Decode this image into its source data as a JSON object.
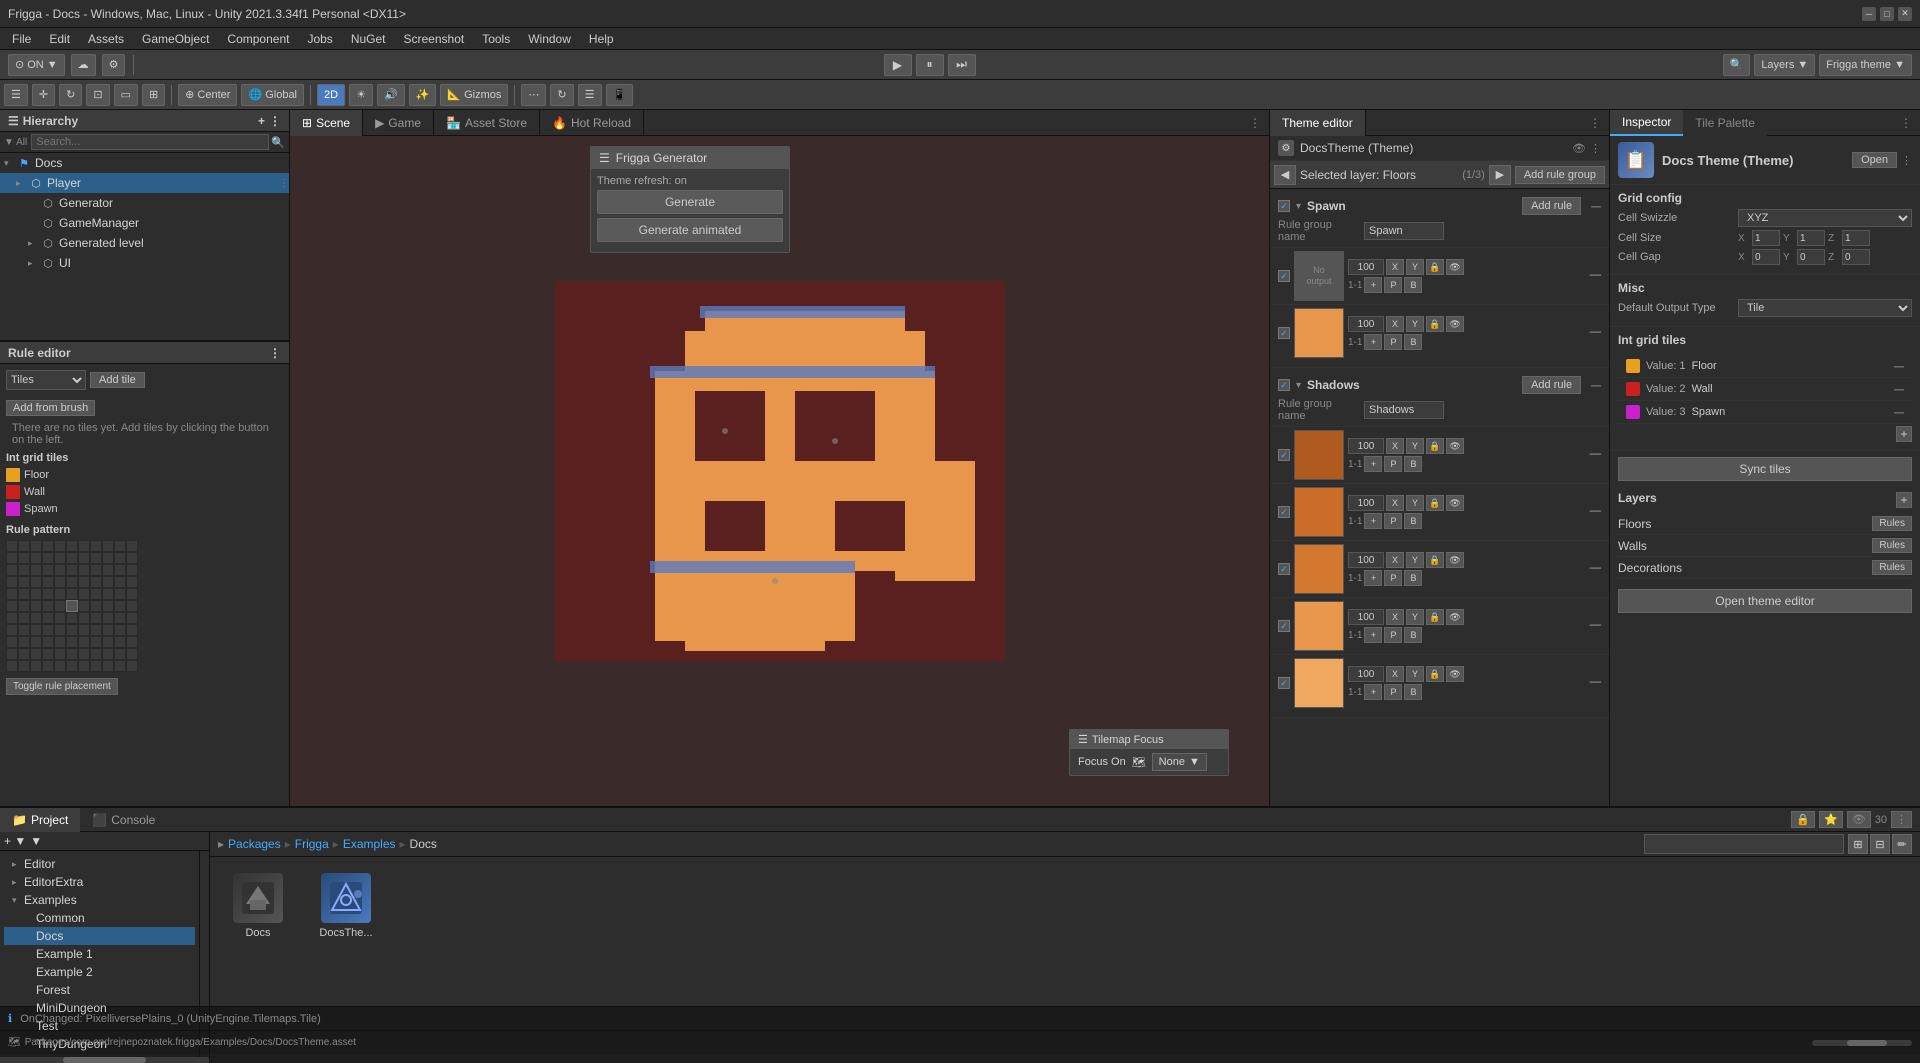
{
  "titlebar": {
    "title": "Frigga - Docs - Windows, Mac, Linux - Unity 2021.3.34f1 Personal <DX11>",
    "buttons": [
      "─",
      "□",
      "✕"
    ]
  },
  "menubar": {
    "items": [
      "File",
      "Edit",
      "Assets",
      "GameObject",
      "Component",
      "Jobs",
      "NuGet",
      "Screenshot",
      "Tools",
      "Window",
      "Help"
    ]
  },
  "toolbar": {
    "left": {
      "toggle_label": "ON",
      "cloud_label": "☁",
      "settings_label": "⚙"
    },
    "play": "▶",
    "pause": "⏸",
    "step": "⏭",
    "right": {
      "layers_label": "Layers",
      "frigga_label": "Frigga theme ▼"
    }
  },
  "scene_toolbar": {
    "buttons": [
      "☰",
      "↔",
      "↕",
      "⟲",
      "⊡",
      "2D",
      "☀",
      "⋯",
      "⟲",
      "☰",
      "📱",
      "☁",
      "📐"
    ]
  },
  "hierarchy": {
    "title": "Hierarchy",
    "search_placeholder": "Search...",
    "items": [
      {
        "label": "Docs",
        "depth": 0,
        "type": "scene",
        "expanded": true
      },
      {
        "label": "Player",
        "depth": 1,
        "type": "gameobject",
        "selected": true,
        "expanded": false
      },
      {
        "label": "Generator",
        "depth": 2,
        "type": "gameobject"
      },
      {
        "label": "GameManager",
        "depth": 2,
        "type": "gameobject"
      },
      {
        "label": "Generated level",
        "depth": 2,
        "type": "gameobject",
        "expanded": false
      },
      {
        "label": "UI",
        "depth": 2,
        "type": "gameobject",
        "expanded": false
      }
    ]
  },
  "scene_tabs": {
    "tabs": [
      "Scene",
      "Game",
      "Asset Store",
      "Hot Reload"
    ],
    "active": 0
  },
  "frigga_generator": {
    "title": "Frigga Generator",
    "theme_refresh": "Theme refresh: on",
    "generate_btn": "Generate",
    "generate_animated_btn": "Generate animated"
  },
  "tilemap_focus": {
    "title": "Tilemap Focus",
    "focus_on_label": "Focus On",
    "none_option": "None",
    "icon": "🗺"
  },
  "theme_editor": {
    "title": "Theme editor",
    "docs_theme": "DocsTheme (Theme)",
    "layer_nav": {
      "prev": "◀",
      "label": "Selected layer: Floors",
      "page": "(1/3)",
      "next": "▶"
    },
    "add_rule_group_btn": "Add rule group",
    "rule_groups": [
      {
        "name": "Spawn",
        "expanded": true,
        "add_rule": "Add rule",
        "rules": [
          {
            "type": "no_output",
            "value": 100
          },
          {
            "type": "tile",
            "value": 100,
            "color": "#e8964c"
          }
        ]
      },
      {
        "name": "Shadows",
        "expanded": true,
        "add_rule": "Add rule",
        "rules": [
          {
            "type": "tile",
            "value": 100,
            "color": "#b05a20"
          },
          {
            "type": "tile",
            "value": 100,
            "color": "#cc6e2a"
          },
          {
            "type": "tile",
            "value": 100,
            "color": "#c96a28"
          },
          {
            "type": "tile",
            "value": 100,
            "color": "#d47830"
          },
          {
            "type": "tile",
            "value": 100,
            "color": "#e8964c"
          }
        ]
      }
    ]
  },
  "inspector": {
    "title": "Inspector",
    "tile_palette": "Tile Palette",
    "docs_theme_name": "Docs Theme (Theme)",
    "open_btn": "Open",
    "grid_config": {
      "title": "Grid config",
      "cell_swizzle_label": "Cell Swizzle",
      "cell_swizzle_value": "XYZ",
      "cell_size_label": "Cell Size",
      "cell_size_x": "1",
      "cell_size_y": "1",
      "cell_size_z": "1",
      "cell_gap_label": "Cell Gap",
      "cell_gap_x": "0",
      "cell_gap_y": "0",
      "cell_gap_z": "0"
    },
    "misc": {
      "title": "Misc",
      "default_output_label": "Default Output Type",
      "default_output_value": "Tile"
    },
    "int_grid_tiles": {
      "title": "Int grid tiles",
      "tiles": [
        {
          "color": "#e8a020",
          "value": "Value: 1",
          "name": "Floor"
        },
        {
          "color": "#cc2020",
          "value": "Value: 2",
          "name": "Wall"
        },
        {
          "color": "#cc20cc",
          "value": "Value: 3",
          "name": "Spawn"
        }
      ]
    },
    "sync_tiles_btn": "Sync tiles",
    "layers": {
      "title": "Layers",
      "items": [
        {
          "name": "Floors",
          "rules_btn": "Rules"
        },
        {
          "name": "Walls",
          "rules_btn": "Rules"
        },
        {
          "name": "Decorations",
          "rules_btn": "Rules"
        }
      ]
    },
    "open_theme_btn": "Open theme editor"
  },
  "rule_editor": {
    "title": "Rule editor",
    "type_select": "Tiles",
    "add_tile_btn": "Add tile",
    "add_from_brush_btn": "Add from brush",
    "hint": "There are no tiles yet. Add tiles by clicking the button on the left.",
    "int_grid_tiles": {
      "title": "Int grid tiles",
      "items": [
        {
          "color": "#e8a020",
          "name": "Floor"
        },
        {
          "color": "#cc2020",
          "name": "Wall"
        },
        {
          "color": "#cc20cc",
          "name": "Spawn"
        }
      ]
    },
    "rule_pattern": {
      "title": "Rule pattern",
      "grid_size": 11
    },
    "toggle_btn": "Toggle rule placement"
  },
  "project": {
    "title": "Project",
    "console_tab": "Console",
    "search_placeholder": "",
    "breadcrumb": [
      "Packages",
      "Frigga",
      "Examples",
      "Docs"
    ],
    "tree": {
      "items": [
        {
          "label": "Editor",
          "depth": 0
        },
        {
          "label": "EditorExtra",
          "depth": 0
        },
        {
          "label": "Examples",
          "depth": 0,
          "expanded": true
        },
        {
          "label": "Common",
          "depth": 1
        },
        {
          "label": "Docs",
          "depth": 1,
          "selected": true
        },
        {
          "label": "Example 1",
          "depth": 1
        },
        {
          "label": "Example 2",
          "depth": 1
        },
        {
          "label": "Forest",
          "depth": 1
        },
        {
          "label": "MiniDungeon",
          "depth": 1
        },
        {
          "label": "Test",
          "depth": 1
        },
        {
          "label": "TinyDungeon",
          "depth": 1
        }
      ]
    },
    "assets": [
      {
        "name": "Docs",
        "type": "unity"
      },
      {
        "name": "DocsThe...",
        "type": "frigga"
      }
    ],
    "count": "30"
  },
  "statusbar": {
    "message": "OnChanged: PixelliversePlains_0 (UnityEngine.Tilemaps.Tile)"
  },
  "layers_tab": {
    "label": "Layers",
    "frigga_label": "Frigga theme ▼"
  },
  "decorations_rules": "Rules",
  "wall_label": "Wall"
}
